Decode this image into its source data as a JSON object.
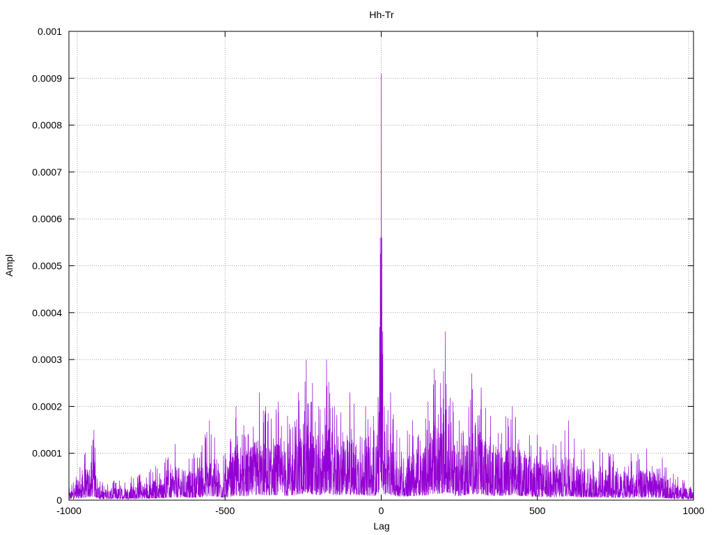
{
  "chart_data": {
    "type": "line",
    "title": "Hh-Tr",
    "xlabel": "Lag",
    "ylabel": "Ampl",
    "xlim": [
      -1000,
      1000
    ],
    "ylim": [
      0,
      0.001
    ],
    "x_ticks": [
      -1000,
      -500,
      0,
      500,
      1000
    ],
    "x_tick_labels": [
      "-1000",
      "-500",
      "0",
      "500",
      "1000"
    ],
    "y_ticks": [
      0,
      0.0001,
      0.0002,
      0.0003,
      0.0004,
      0.0005,
      0.0006,
      0.0007,
      0.0008,
      0.0009,
      0.001
    ],
    "y_tick_labels": [
      "0",
      "0.0001",
      "0.0002",
      "0.0003",
      "0.0004",
      "0.0005",
      "0.0006",
      "0.0007",
      "0.0008",
      "0.0009",
      "0.001"
    ],
    "grid": true,
    "series": [
      {
        "color": "#9400d3",
        "x": [
          -1000,
          -920,
          -900,
          -800,
          -690,
          -660,
          -600,
          -550,
          -500,
          -465,
          -440,
          -390,
          -370,
          -330,
          -300,
          -265,
          -240,
          -220,
          -200,
          -175,
          -150,
          -100,
          -50,
          -25,
          -10,
          -3,
          0,
          2,
          5,
          10,
          30,
          50,
          100,
          150,
          170,
          190,
          205,
          230,
          250,
          290,
          320,
          350,
          420,
          500,
          550,
          600,
          650,
          700,
          800,
          850,
          900,
          950,
          1000
        ],
        "y": [
          3e-05,
          0.00015,
          4e-05,
          5e-05,
          9e-05,
          0.00012,
          0.0001,
          0.00017,
          0.0001,
          0.0002,
          0.00016,
          0.00023,
          0.0002,
          0.00021,
          0.00018,
          0.00023,
          0.0003,
          0.00025,
          0.0002,
          0.0003,
          0.0002,
          0.00023,
          0.0002,
          0.00018,
          0.00022,
          0.00056,
          0.00091,
          0.00056,
          0.00036,
          0.0002,
          0.00023,
          0.00015,
          0.00017,
          0.00021,
          0.00028,
          0.00025,
          0.00036,
          0.00021,
          0.00017,
          0.00027,
          0.00024,
          0.00018,
          0.0002,
          0.00014,
          0.00012,
          0.00017,
          0.00011,
          0.00011,
          0.0001,
          0.00011,
          9e-05,
          5e-05,
          4e-05
        ]
      }
    ]
  }
}
